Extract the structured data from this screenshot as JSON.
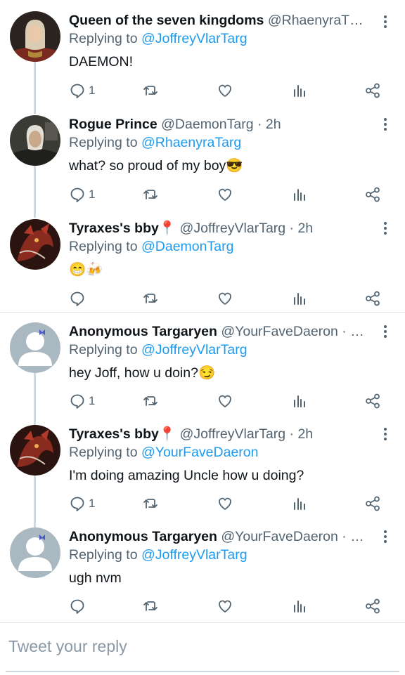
{
  "tweets": [
    {
      "name": "Queen of the seven kingdoms",
      "handle": "@RhaenyraT…",
      "reply_to_prefix": "Replying to",
      "reply_to": "@JoffreyVlarTarg",
      "text": "DAEMON!",
      "reply_count": "1",
      "avatar": "avatar-portrait-queen"
    },
    {
      "name": "Rogue Prince",
      "handle": "@DaemonTarg · 2h",
      "reply_to_prefix": "Replying to",
      "reply_to": "@RhaenyraTarg",
      "text": "what? so proud of my boy",
      "text_emoji": "😎",
      "reply_count": "1",
      "avatar": "avatar-portrait-prince"
    },
    {
      "name": "Tyraxes's bby",
      "name_emoji": "📍",
      "handle": "@JoffreyVlarTarg · 2h",
      "reply_to_prefix": "Replying to",
      "reply_to": "@DaemonTarg",
      "text": "",
      "text_emoji": "😁🍻",
      "reply_count": "",
      "avatar": "avatar-dragon"
    },
    {
      "name": "Anonymous Targaryen",
      "handle": "@YourFaveDaeron · …",
      "reply_to_prefix": "Replying to",
      "reply_to": "@JoffreyVlarTarg",
      "text": "hey Joff, how u doin?",
      "text_emoji": "😏",
      "reply_count": "1",
      "avatar": "avatar-default"
    },
    {
      "name": "Tyraxes's bby",
      "name_emoji": "📍",
      "handle": "@JoffreyVlarTarg · 2h",
      "reply_to_prefix": "Replying to",
      "reply_to": "@YourFaveDaeron",
      "text": "I'm doing amazing Uncle how u doing?",
      "reply_count": "1",
      "avatar": "avatar-dragon"
    },
    {
      "name": "Anonymous Targaryen",
      "handle": "@YourFaveDaeron · …",
      "reply_to_prefix": "Replying to",
      "reply_to": "@JoffreyVlarTarg",
      "text": "ugh nvm",
      "reply_count": "",
      "avatar": "avatar-default"
    }
  ],
  "reply_box": {
    "placeholder": "Tweet your reply"
  },
  "colors": {
    "link": "#1d9bf0",
    "secondary": "#536471",
    "thread_line": "#cfd9de"
  },
  "icons": [
    "reply-icon",
    "retweet-icon",
    "like-icon",
    "analytics-icon",
    "share-icon",
    "more-icon"
  ]
}
